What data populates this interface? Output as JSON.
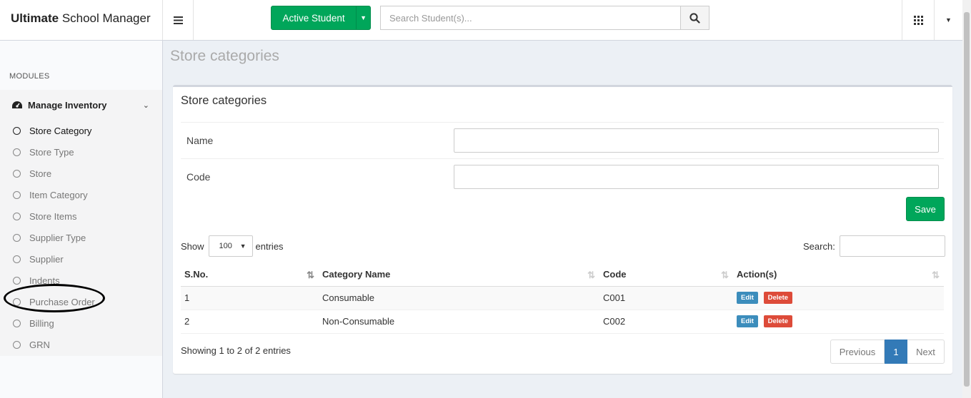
{
  "header": {
    "brand_bold": "Ultimate",
    "brand_rest": "School Manager",
    "active_button": "Active Student",
    "search_placeholder": "Search Student(s)...",
    "icons": [
      "hamburger-icon",
      "caret-down-icon",
      "search-icon",
      "grid-icon",
      "caret-down-icon"
    ]
  },
  "sidebar": {
    "modules_label": "MODULES",
    "menu_title": "Manage Inventory",
    "items": [
      {
        "label": "Store Category",
        "active": true
      },
      {
        "label": "Store Type"
      },
      {
        "label": "Store"
      },
      {
        "label": "Item Category"
      },
      {
        "label": "Store Items"
      },
      {
        "label": "Supplier Type"
      },
      {
        "label": "Supplier"
      },
      {
        "label": "Indents"
      },
      {
        "label": "Purchase Order"
      },
      {
        "label": "Billing"
      },
      {
        "label": "GRN"
      }
    ]
  },
  "page": {
    "title": "Store categories",
    "box_title": "Store categories",
    "form": {
      "name_label": "Name",
      "name_value": "",
      "code_label": "Code",
      "code_value": "",
      "save_label": "Save"
    },
    "table_controls": {
      "show_label": "Show",
      "length_value": "100",
      "entries_label": "entries",
      "search_label": "Search:"
    },
    "table": {
      "columns": [
        "S.No.",
        "Category Name",
        "Code",
        "Action(s)"
      ],
      "rows": [
        {
          "sno": "1",
          "name": "Consumable",
          "code": "C001"
        },
        {
          "sno": "2",
          "name": "Non-Consumable",
          "code": "C002"
        }
      ],
      "edit_label": "Edit",
      "delete_label": "Delete"
    },
    "info": "Showing 1 to 2 of 2 entries",
    "pagination": {
      "previous": "Previous",
      "current": "1",
      "next": "Next"
    }
  },
  "colors": {
    "success": "#00a65a",
    "primary": "#3c8dbc",
    "danger": "#dd4b39",
    "page_bg": "#ecf0f5"
  }
}
